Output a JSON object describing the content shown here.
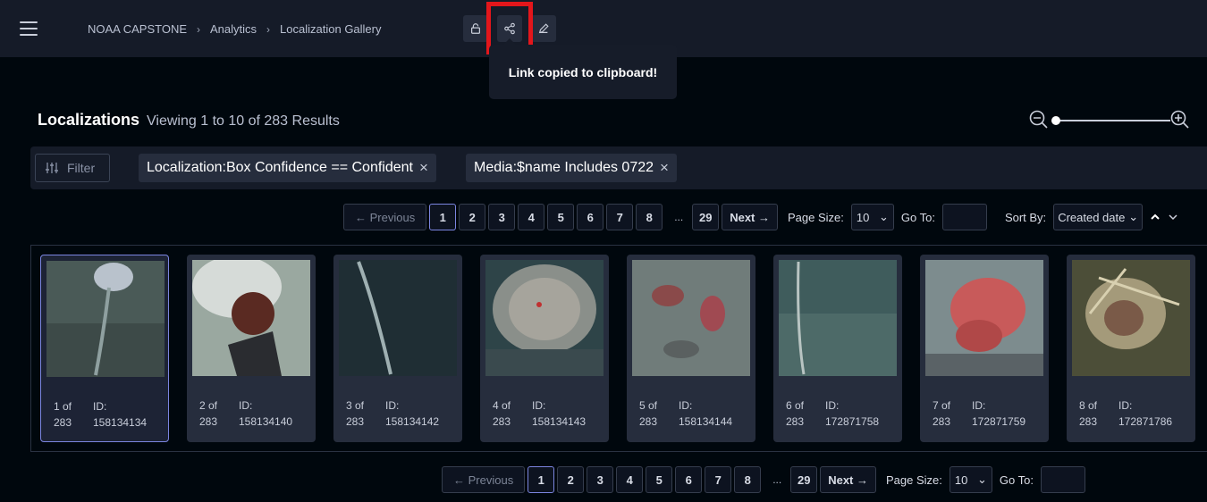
{
  "header": {
    "breadcrumb": [
      "NOAA CAPSTONE",
      "Analytics",
      "Localization Gallery"
    ],
    "tooltip": "Link copied to clipboard!"
  },
  "main": {
    "title": "Localizations",
    "subtitle": "Viewing 1 to 10 of 283 Results"
  },
  "filter": {
    "button_label": "Filter",
    "chips": [
      "Localization:Box Confidence == Confident",
      "Media:$name Includes 0722"
    ]
  },
  "pagination": {
    "previous": "← Previous",
    "next": "Next →",
    "pages": [
      "1",
      "2",
      "3",
      "4",
      "5",
      "6",
      "7",
      "8"
    ],
    "ellipsis": "...",
    "last_page": "29",
    "current_page": "1",
    "page_size_label": "Page Size:",
    "page_size": "10",
    "goto_label": "Go To:",
    "sort_label": "Sort By:",
    "sort_value": "Created date"
  },
  "cards": [
    {
      "index": "1 of",
      "total": "283",
      "id_label": "ID:",
      "id": "158134134"
    },
    {
      "index": "2 of",
      "total": "283",
      "id_label": "ID:",
      "id": "158134140"
    },
    {
      "index": "3 of",
      "total": "283",
      "id_label": "ID:",
      "id": "158134142"
    },
    {
      "index": "4 of",
      "total": "283",
      "id_label": "ID:",
      "id": "158134143"
    },
    {
      "index": "5 of",
      "total": "283",
      "id_label": "ID:",
      "id": "158134144"
    },
    {
      "index": "6 of",
      "total": "283",
      "id_label": "ID:",
      "id": "172871758"
    },
    {
      "index": "7 of",
      "total": "283",
      "id_label": "ID:",
      "id": "172871759"
    },
    {
      "index": "8 of",
      "total": "283",
      "id_label": "ID:",
      "id": "172871786"
    }
  ],
  "colors": {
    "accent": "#7b85e0",
    "highlight": "#e3161b",
    "header_bg": "#151b28",
    "page_bg": "#00070d"
  }
}
